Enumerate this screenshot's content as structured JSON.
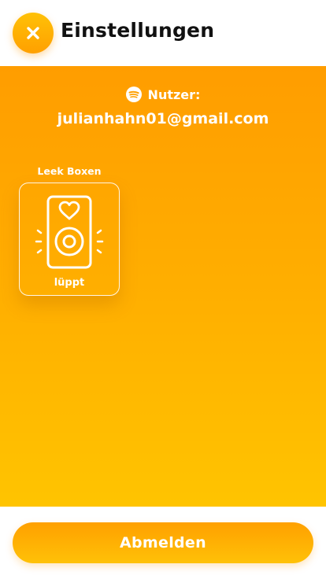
{
  "header": {
    "title": "Einstellungen",
    "close_icon": "close-icon"
  },
  "account": {
    "label": "Nutzer:",
    "email": "julianhahn01@gmail.com",
    "service_icon": "spotify-icon"
  },
  "devices": {
    "group_title": "Leek Boxen",
    "items": [
      {
        "label": "lüppt",
        "icon": "speaker-heart-icon"
      }
    ]
  },
  "footer": {
    "logout_label": "Abmelden"
  },
  "colors": {
    "accent": "#ffa000",
    "accent_light": "#ffc107",
    "text_dark": "#111111",
    "text_light": "#ffffff"
  }
}
